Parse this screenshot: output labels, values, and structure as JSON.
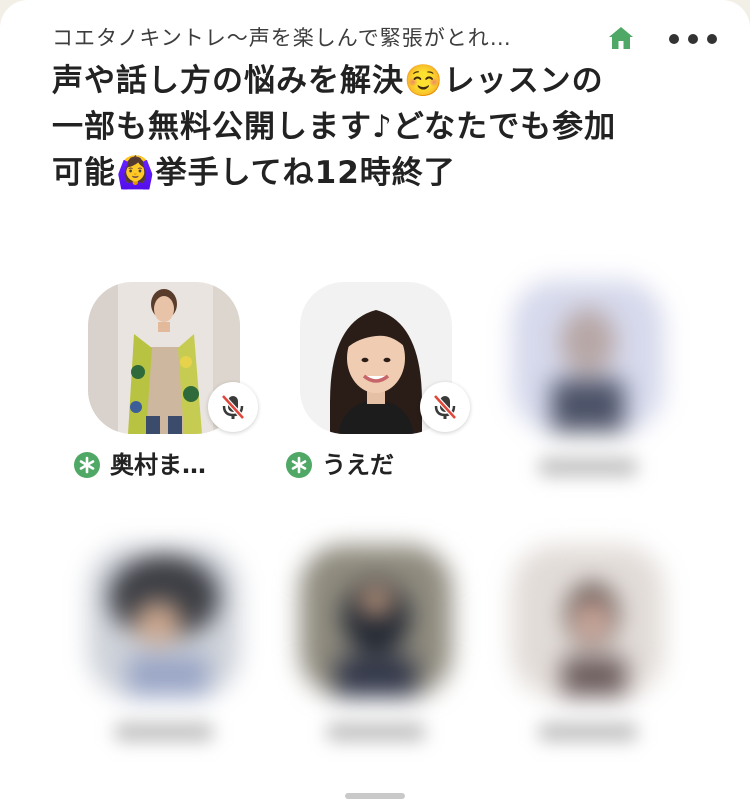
{
  "room": {
    "club_name": "コエタノキントレ〜声を楽しんで緊張がとれ…",
    "title": "声や話し方の悩みを解決☺️レッスンの一部も無料公開します♪どなたでも参加可能🙆‍♀️挙手してね12時終了",
    "home_icon": "house-icon",
    "more_icon": "ellipsis-icon"
  },
  "speakers": [
    {
      "name": "奥村ま…",
      "moderator": true,
      "muted": true
    },
    {
      "name": "うえだ",
      "moderator": true,
      "muted": true
    }
  ],
  "colors": {
    "accent": "#4fa866",
    "background": "#ffffff",
    "mute_slash": "#e0463a"
  }
}
